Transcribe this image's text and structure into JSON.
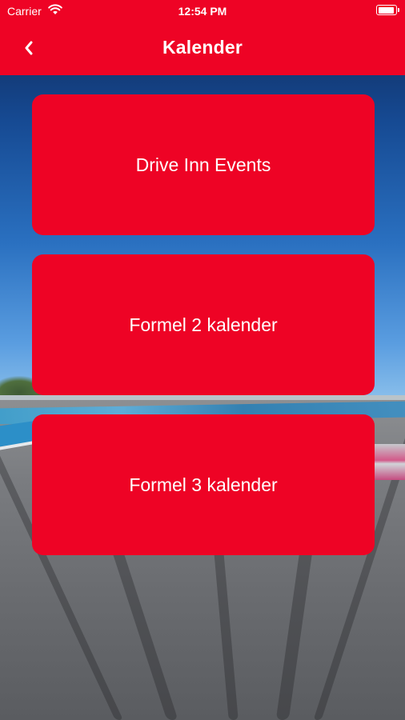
{
  "status_bar": {
    "carrier": "Carrier",
    "time": "12:54 PM",
    "icons": [
      "wifi-icon",
      "battery-icon"
    ]
  },
  "nav": {
    "title": "Kalender",
    "back_icon": "chevron-left-icon"
  },
  "menu": {
    "items": [
      {
        "label": "Drive Inn Events"
      },
      {
        "label": "Formel 2 kalender"
      },
      {
        "label": "Formel 3 kalender"
      }
    ]
  },
  "colors": {
    "accent": "#ee0325",
    "text_on_accent": "#ffffff"
  }
}
